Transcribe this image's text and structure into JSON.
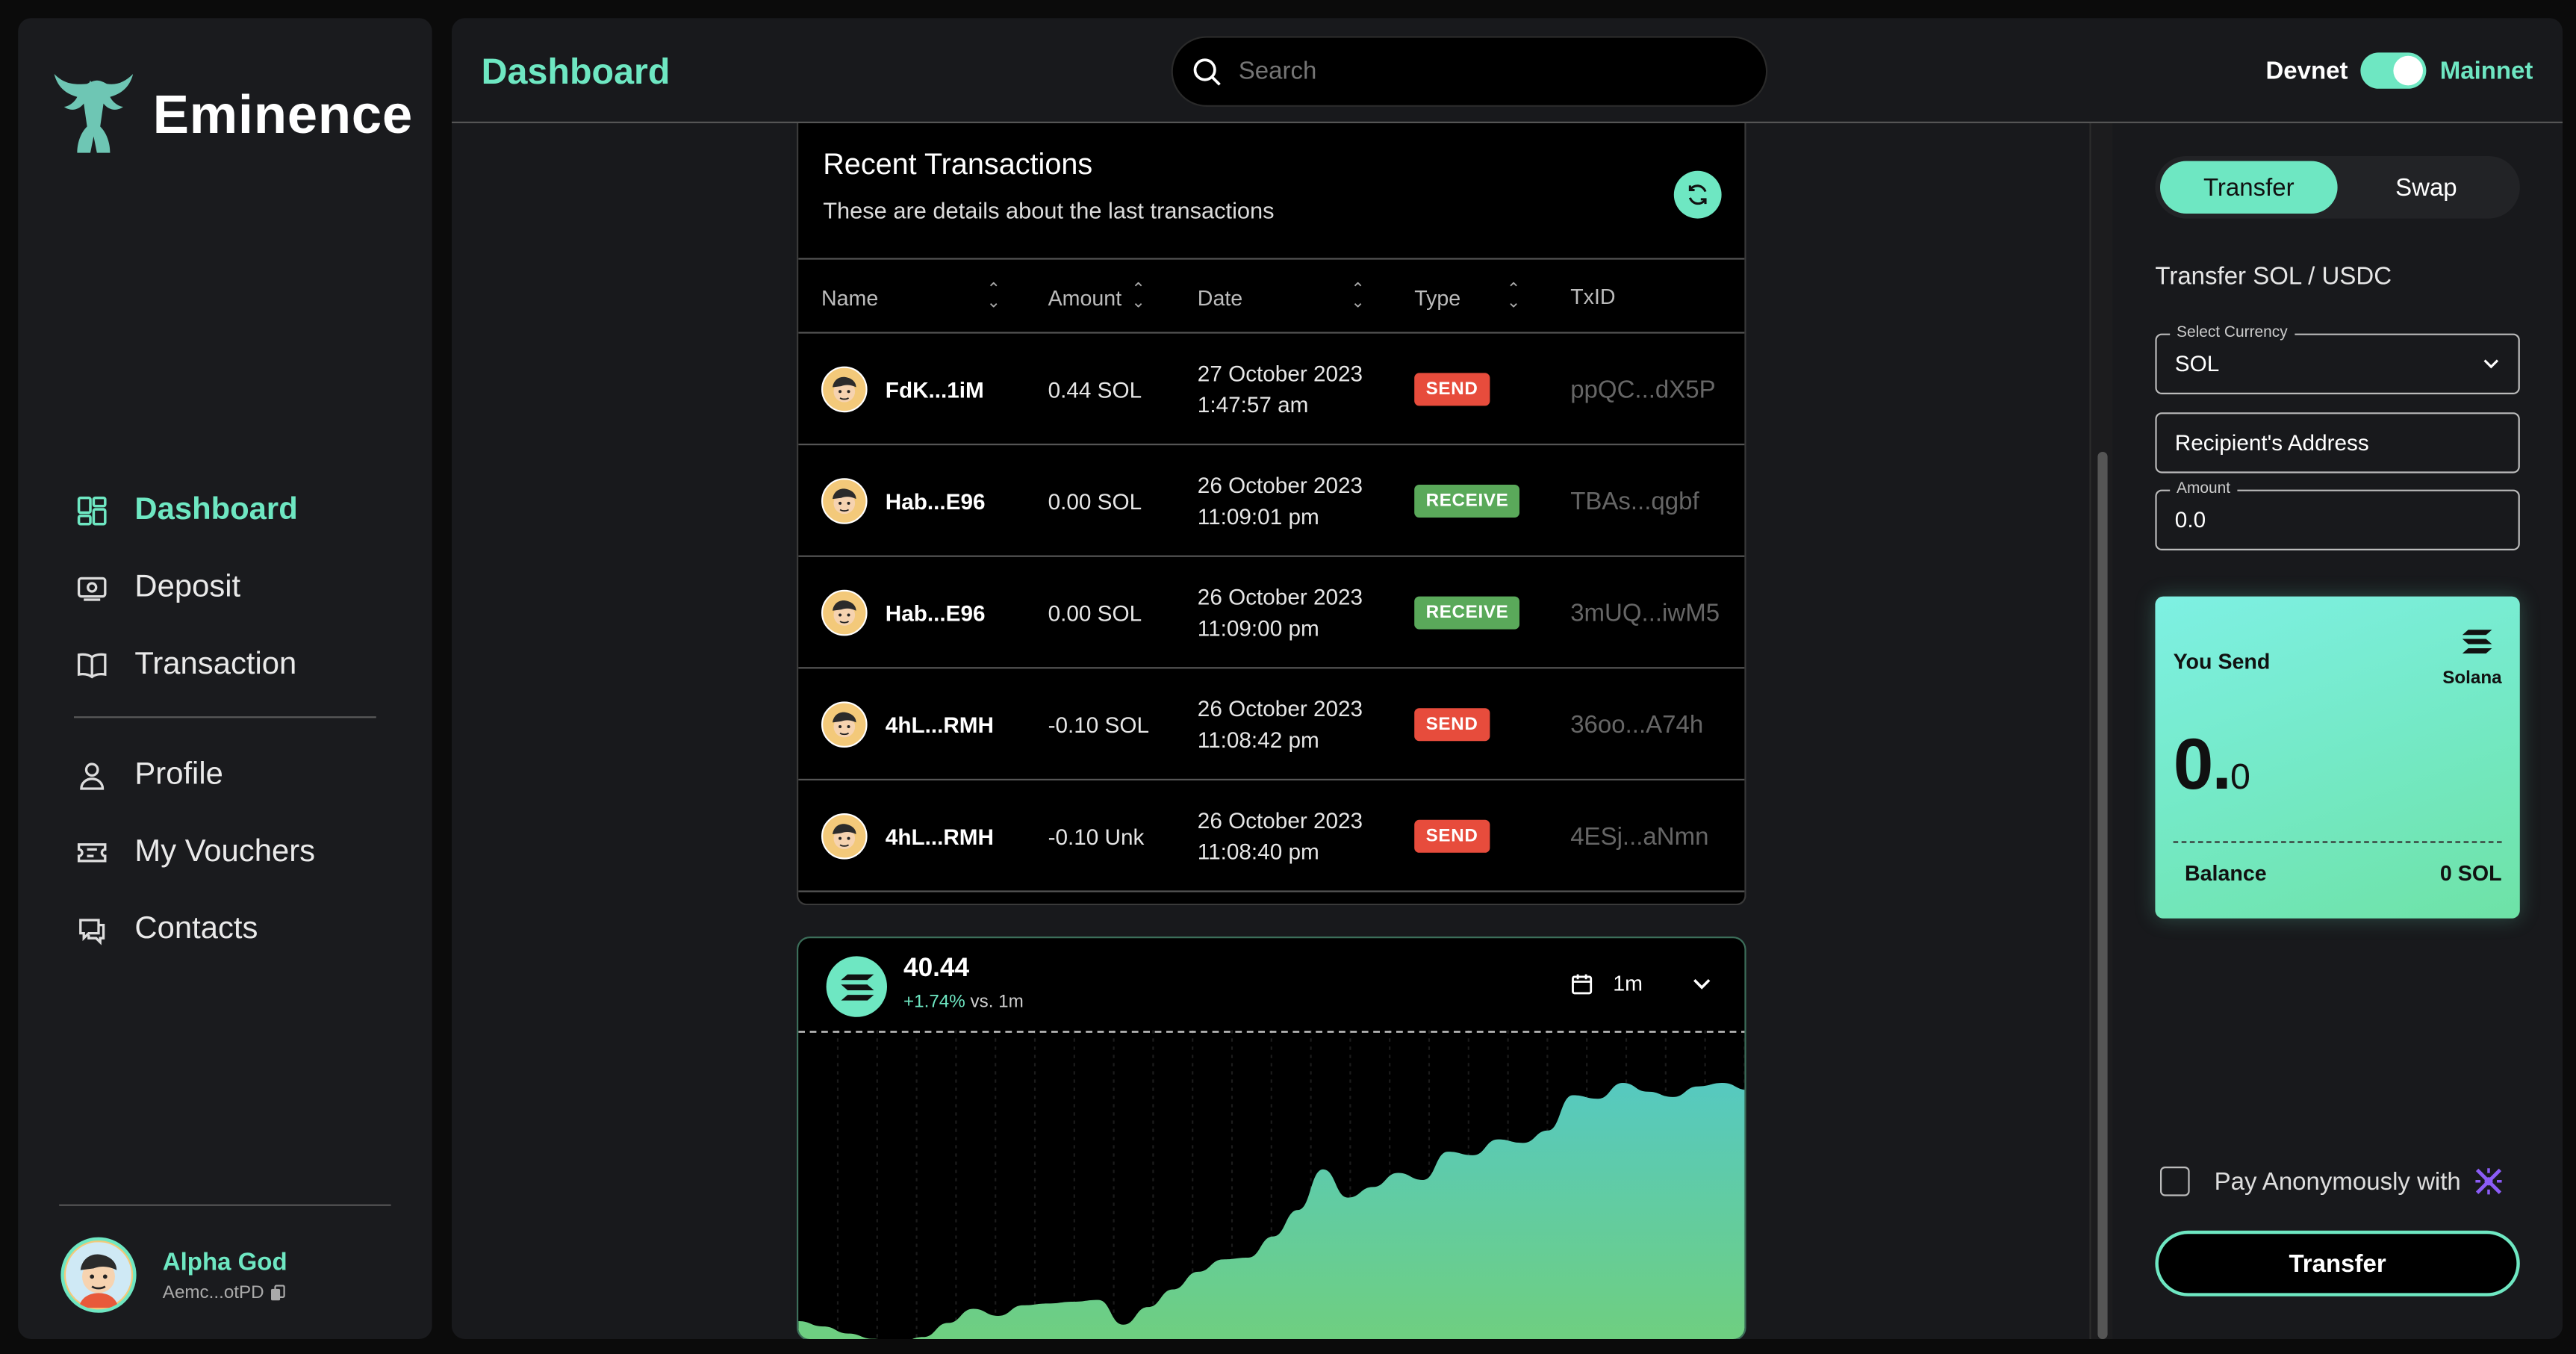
{
  "brand": {
    "name": "Eminence"
  },
  "sidebar": {
    "items": [
      {
        "label": "Dashboard",
        "icon": "dashboard-icon",
        "active": true
      },
      {
        "label": "Deposit",
        "icon": "deposit-icon"
      },
      {
        "label": "Transaction",
        "icon": "book-icon"
      }
    ],
    "items2": [
      {
        "label": "Profile",
        "icon": "user-icon"
      },
      {
        "label": "My Vouchers",
        "icon": "voucher-icon"
      },
      {
        "label": "Contacts",
        "icon": "chat-icon"
      }
    ],
    "user": {
      "name": "Alpha God",
      "address": "Aemc...otPD"
    }
  },
  "header": {
    "title": "Dashboard",
    "search_placeholder": "Search",
    "network_left": "Devnet",
    "network_right": "Mainnet"
  },
  "transactions": {
    "title": "Recent Transactions",
    "subtitle": "These are details about the last transactions",
    "columns": [
      "Name",
      "Amount",
      "Date",
      "Type",
      "TxID"
    ],
    "rows": [
      {
        "name": "FdK...1iM",
        "amount": "0.44 SOL",
        "date": "27 October 2023",
        "time": "1:47:57 am",
        "type": "SEND",
        "txid": "ppQC...dX5P"
      },
      {
        "name": "Hab...E96",
        "amount": "0.00 SOL",
        "date": "26 October 2023",
        "time": "11:09:01 pm",
        "type": "RECEIVE",
        "txid": "TBAs...qgbf"
      },
      {
        "name": "Hab...E96",
        "amount": "0.00 SOL",
        "date": "26 October 2023",
        "time": "11:09:00 pm",
        "type": "RECEIVE",
        "txid": "3mUQ...iwM5"
      },
      {
        "name": "4hL...RMH",
        "amount": "-0.10 SOL",
        "date": "26 October 2023",
        "time": "11:08:42 pm",
        "type": "SEND",
        "txid": "36oo...A74h"
      },
      {
        "name": "4hL...RMH",
        "amount": "-0.10 Unk",
        "date": "26 October 2023",
        "time": "11:08:40 pm",
        "type": "SEND",
        "txid": "4ESj...aNmn"
      }
    ]
  },
  "price_card": {
    "price": "40.44",
    "change": "+1.74%",
    "change_suffix": " vs. 1m",
    "period": "1m"
  },
  "chart_data": {
    "type": "area",
    "title": "",
    "xlabel": "",
    "ylabel": "",
    "values": [
      12,
      9,
      5,
      2,
      0,
      3,
      11,
      19,
      15,
      21,
      22,
      23,
      24,
      10,
      20,
      30,
      40,
      47,
      48,
      60,
      75,
      98,
      82,
      88,
      96,
      92,
      108,
      106,
      115,
      113,
      120,
      140,
      138,
      147,
      142,
      139,
      145,
      147,
      143
    ],
    "ylim": [
      0,
      175
    ],
    "grid": true
  },
  "transfer_panel": {
    "tabs": [
      "Transfer",
      "Swap"
    ],
    "heading": "Transfer SOL / USDC",
    "currency_label": "Select Currency",
    "currency_value": "SOL",
    "recipient_placeholder": "Recipient's Address",
    "amount_label": "Amount",
    "amount_value": "0.0",
    "you_send": "You Send",
    "coin_name": "Solana",
    "amount_big": "0.",
    "amount_small": "0",
    "balance_label": "Balance",
    "balance_value": "0 SOL",
    "anon_label": "Pay Anonymously with",
    "submit": "Transfer"
  },
  "colors": {
    "accent": "#6ee7c2",
    "send": "#e74c3c",
    "receive": "#5aa95a"
  }
}
